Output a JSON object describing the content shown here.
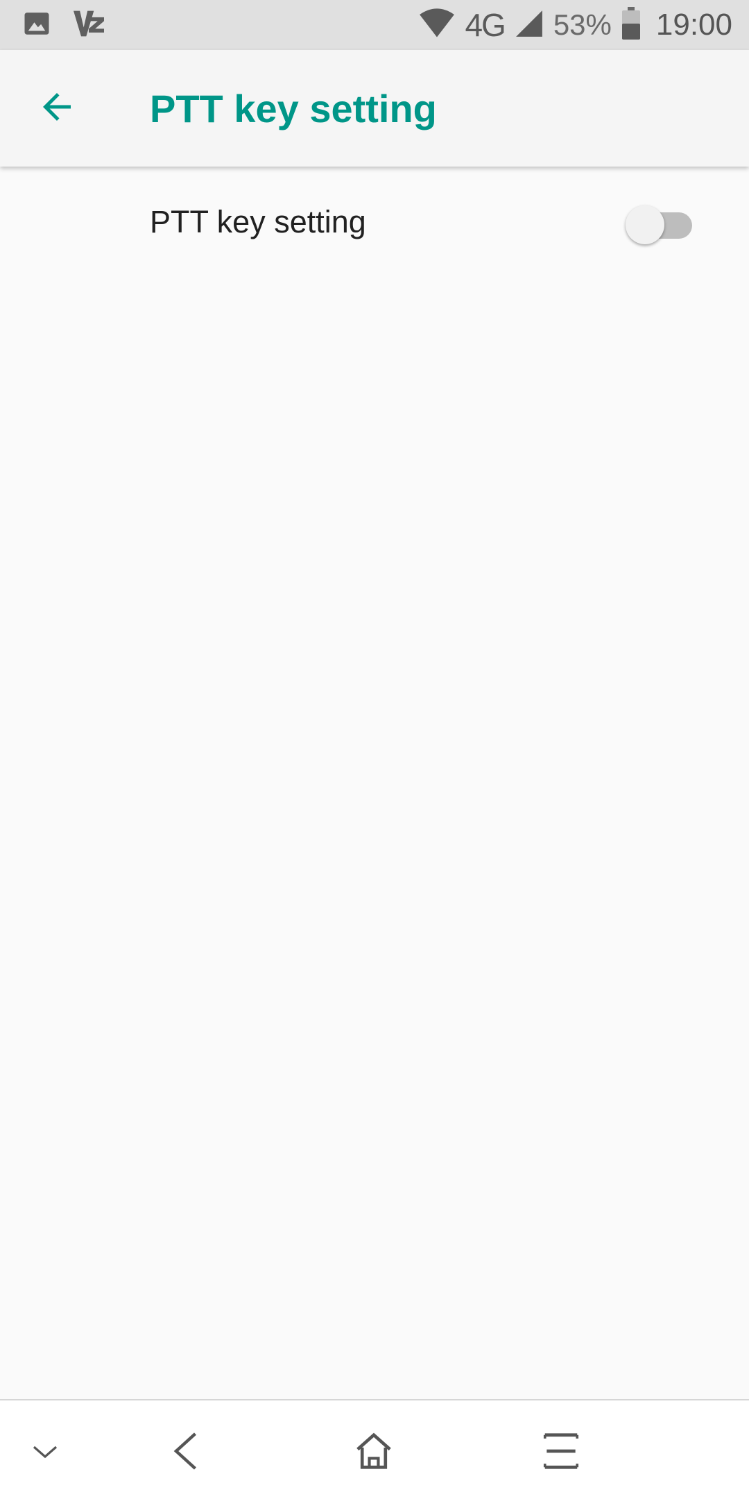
{
  "status_bar": {
    "network": "4G",
    "battery": "53%",
    "time": "19:00",
    "icons": [
      "image-icon",
      "vpn-key-icon",
      "wifi-icon",
      "cell-signal-icon",
      "battery-icon"
    ]
  },
  "app_bar": {
    "title": "PTT key setting",
    "back_icon": "back-arrow-icon"
  },
  "settings": [
    {
      "label": "PTT key setting",
      "enabled": false
    }
  ],
  "nav_bar": {
    "icons": [
      "collapse-chevron-icon",
      "back-nav-icon",
      "home-icon",
      "recents-menu-icon"
    ]
  },
  "colors": {
    "accent": "#009688",
    "status_bar_bg": "#e0e0e0",
    "app_bar_bg": "#f5f5f5",
    "background": "#fafafa",
    "switch_track_off": "#bdbdbd"
  }
}
